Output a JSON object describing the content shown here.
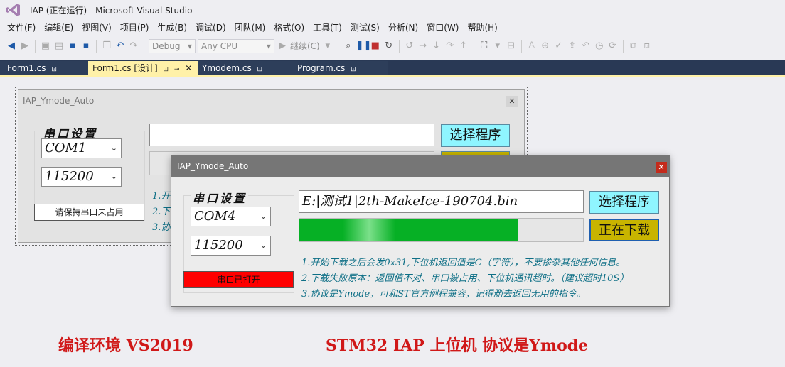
{
  "app": {
    "title": "IAP (正在运行) - Microsoft Visual Studio"
  },
  "menu": {
    "items": [
      "文件(F)",
      "编辑(E)",
      "视图(V)",
      "项目(P)",
      "生成(B)",
      "调试(D)",
      "团队(M)",
      "格式(O)",
      "工具(T)",
      "测试(S)",
      "分析(N)",
      "窗口(W)",
      "帮助(H)"
    ]
  },
  "toolbar": {
    "config": "Debug",
    "platform": "Any CPU",
    "continue_label": "继续(C)"
  },
  "tabs": {
    "tab1": "Form1.cs",
    "tab2": "Form1.cs [设计]",
    "tab3": "Ymodem.cs",
    "tab4": "Program.cs"
  },
  "design_form": {
    "title": "IAP_Ymode_Auto",
    "group_title": "串口设置",
    "port": "COM1",
    "baud": "115200",
    "status": "请保持串口未占用",
    "browse_label": "选择程序",
    "notes": [
      "1.开",
      "2.下",
      "3.协"
    ]
  },
  "run_form": {
    "title": "IAP_Ymode_Auto",
    "group_title": "串口设置",
    "port": "COM4",
    "baud": "115200",
    "status": "串口已打开",
    "file_path": "E:|测试1|2th-MakeIce-190704.bin",
    "browse_label": "选择程序",
    "download_label": "正在下载",
    "progress": 0.77,
    "notes": [
      "1.开始下载之后会发0x31,下位机返回值是C（字符），不要掺杂其他任何信息。",
      "2.下载失败原本：返回值不对、串口被占用、下位机通讯超时。（建议超时10S）",
      "3.协议是Ymode，可和ST官方例程兼容，记得删去返回无用的指令。"
    ]
  },
  "captions": {
    "left": "编译环境 VS2019",
    "right": "STM32 IAP 上位机    协议是Ymode"
  },
  "colors": {
    "progress": "#06b025",
    "browse_button": "#8ff5ff",
    "download_button": "#c8b400",
    "status_open": "#ff0000",
    "caption": "#d01818",
    "notes": "#0e6f86"
  },
  "icons": [
    "visual-studio-logo-icon",
    "back-icon",
    "forward-icon",
    "save-icon",
    "save-all-icon",
    "undo-icon",
    "redo-icon",
    "play-icon",
    "pause-icon",
    "stop-icon",
    "restart-icon",
    "pin-icon",
    "close-icon",
    "dropdown-arrow-icon"
  ]
}
